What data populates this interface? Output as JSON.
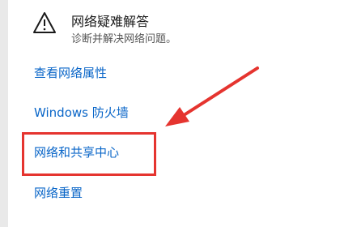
{
  "troubleshoot": {
    "title": "网络疑难解答",
    "subtitle": "诊断并解决网络问题。",
    "icon": "warning-icon"
  },
  "links": {
    "view_properties": "查看网络属性",
    "firewall": "Windows 防火墙",
    "sharing_center": "网络和共享中心",
    "network_reset": "网络重置"
  },
  "colors": {
    "link": "#0a66c8",
    "annotation": "#e5342f"
  }
}
